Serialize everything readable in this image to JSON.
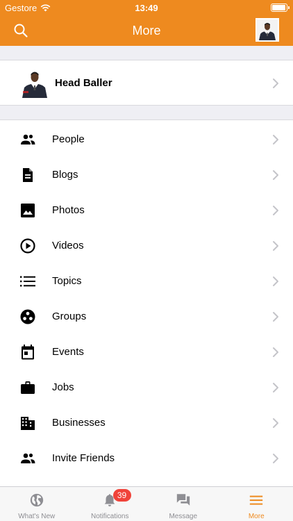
{
  "status_bar": {
    "carrier": "Gestore",
    "time": "13:49"
  },
  "header": {
    "title": "More",
    "search_icon": "search-icon",
    "avatar": "user-avatar"
  },
  "profile": {
    "name": "Head Baller"
  },
  "menu": {
    "items": [
      {
        "label": "People",
        "icon": "people-icon"
      },
      {
        "label": "Blogs",
        "icon": "document-icon"
      },
      {
        "label": "Photos",
        "icon": "image-icon"
      },
      {
        "label": "Videos",
        "icon": "play-circle-icon"
      },
      {
        "label": "Topics",
        "icon": "list-icon"
      },
      {
        "label": "Groups",
        "icon": "groups-icon"
      },
      {
        "label": "Events",
        "icon": "calendar-icon"
      },
      {
        "label": "Jobs",
        "icon": "briefcase-icon"
      },
      {
        "label": "Businesses",
        "icon": "building-icon"
      },
      {
        "label": "Invite Friends",
        "icon": "people-icon"
      }
    ]
  },
  "tabbar": {
    "tabs": [
      {
        "label": "What's New",
        "icon": "globe-icon"
      },
      {
        "label": "Notifications",
        "icon": "bell-icon",
        "badge": "39"
      },
      {
        "label": "Message",
        "icon": "chat-icon"
      },
      {
        "label": "More",
        "icon": "menu-icon",
        "active": true
      }
    ]
  },
  "colors": {
    "accent": "#ee8a1f",
    "badge": "#f0433a",
    "tab_inactive": "#8e8e93"
  }
}
